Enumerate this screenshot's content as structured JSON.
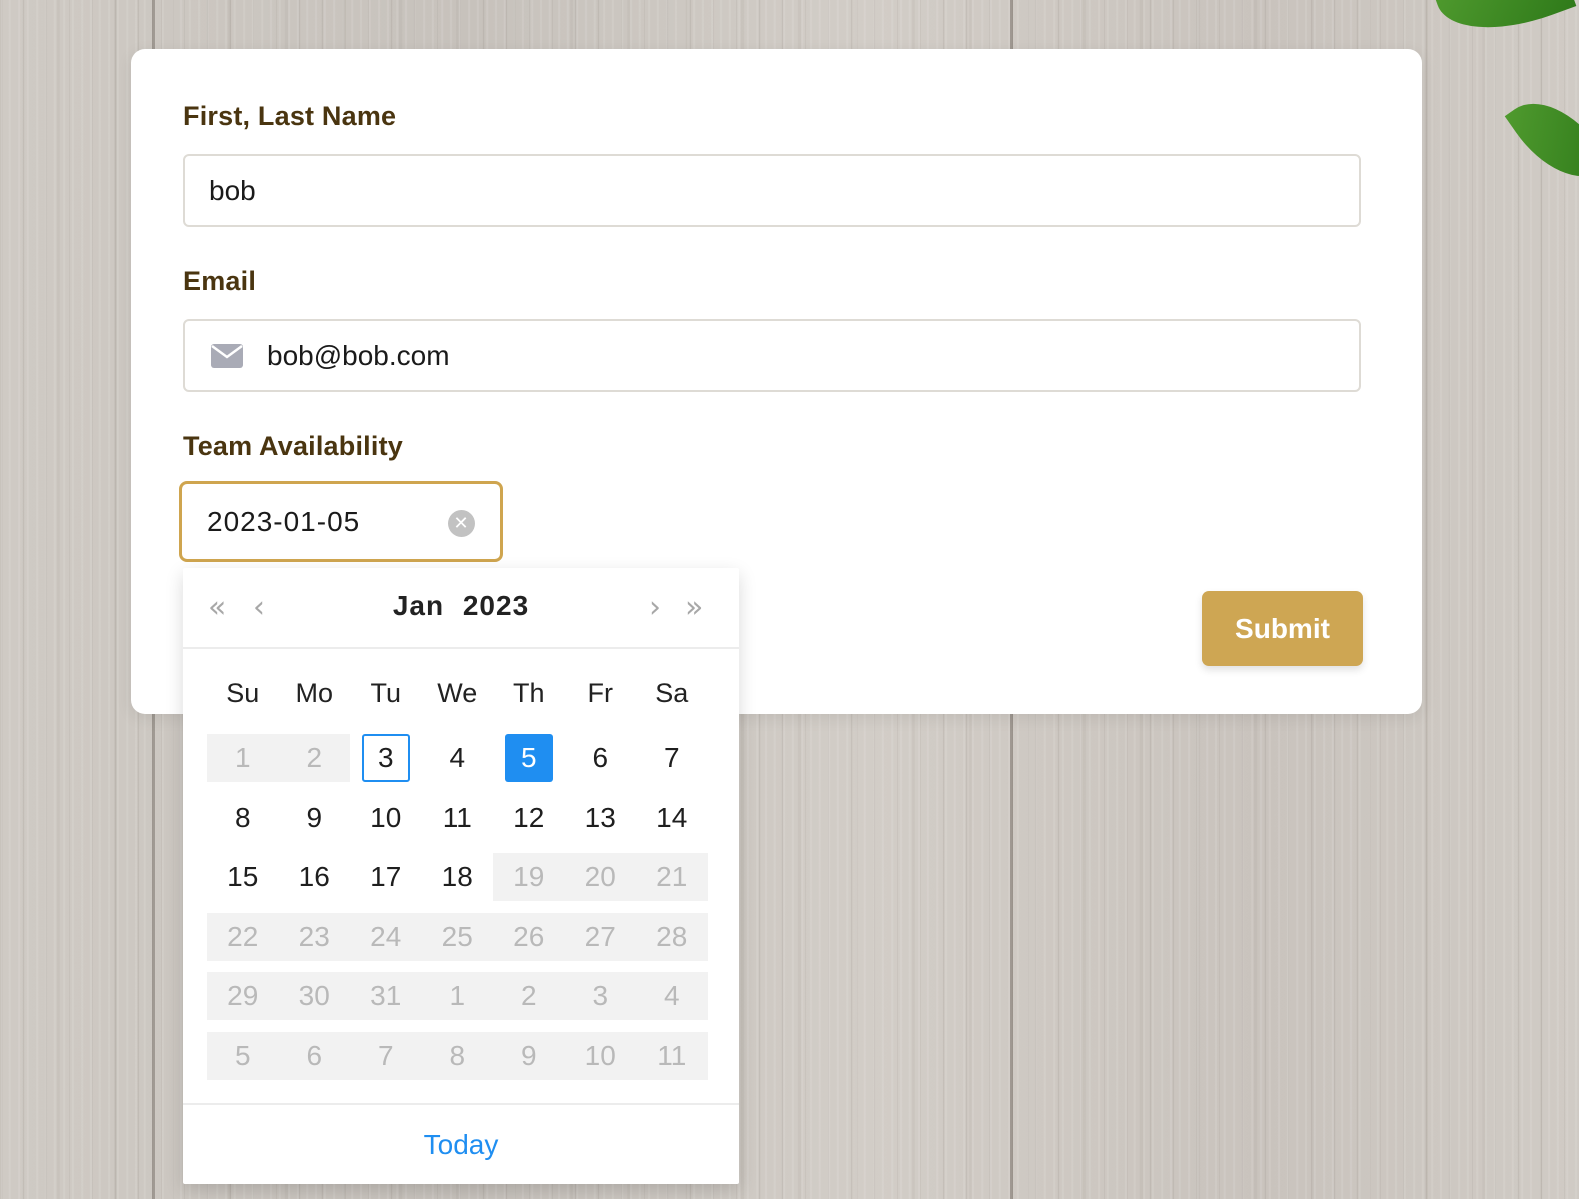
{
  "form": {
    "name_label": "First, Last Name",
    "name_value": "bob",
    "email_label": "Email",
    "email_value": "bob@bob.com",
    "availability_label": "Team Availability",
    "date_value": "2023-01-05",
    "submit_label": "Submit"
  },
  "calendar": {
    "month": "Jan",
    "year": "2023",
    "nav": {
      "prev_year": "«",
      "prev_month": "‹",
      "next_month": "›",
      "next_year": "»"
    },
    "weekdays": [
      "Su",
      "Mo",
      "Tu",
      "We",
      "Th",
      "Fr",
      "Sa"
    ],
    "weeks": [
      [
        {
          "d": "1",
          "disabled": true
        },
        {
          "d": "2",
          "disabled": true
        },
        {
          "d": "3",
          "today": true
        },
        {
          "d": "4"
        },
        {
          "d": "5",
          "selected": true
        },
        {
          "d": "6"
        },
        {
          "d": "7"
        }
      ],
      [
        {
          "d": "8"
        },
        {
          "d": "9"
        },
        {
          "d": "10"
        },
        {
          "d": "11"
        },
        {
          "d": "12"
        },
        {
          "d": "13"
        },
        {
          "d": "14"
        }
      ],
      [
        {
          "d": "15"
        },
        {
          "d": "16"
        },
        {
          "d": "17"
        },
        {
          "d": "18"
        },
        {
          "d": "19",
          "disabled": true
        },
        {
          "d": "20",
          "disabled": true
        },
        {
          "d": "21",
          "disabled": true
        }
      ],
      [
        {
          "d": "22",
          "disabled": true
        },
        {
          "d": "23",
          "disabled": true
        },
        {
          "d": "24",
          "disabled": true
        },
        {
          "d": "25",
          "disabled": true
        },
        {
          "d": "26",
          "disabled": true
        },
        {
          "d": "27",
          "disabled": true
        },
        {
          "d": "28",
          "disabled": true
        }
      ],
      [
        {
          "d": "29",
          "disabled": true
        },
        {
          "d": "30",
          "disabled": true
        },
        {
          "d": "31",
          "disabled": true
        },
        {
          "d": "1",
          "disabled": true
        },
        {
          "d": "2",
          "disabled": true
        },
        {
          "d": "3",
          "disabled": true
        },
        {
          "d": "4",
          "disabled": true
        }
      ],
      [
        {
          "d": "5",
          "disabled": true
        },
        {
          "d": "6",
          "disabled": true
        },
        {
          "d": "7",
          "disabled": true
        },
        {
          "d": "8",
          "disabled": true
        },
        {
          "d": "9",
          "disabled": true
        },
        {
          "d": "10",
          "disabled": true
        },
        {
          "d": "11",
          "disabled": true
        }
      ]
    ],
    "today_label": "Today"
  },
  "icons": {
    "email": "mail-icon",
    "clear": "clear-icon"
  },
  "colors": {
    "label": "#4a3510",
    "accent_gold": "#cea653",
    "calendar_blue": "#1f8ef1"
  }
}
